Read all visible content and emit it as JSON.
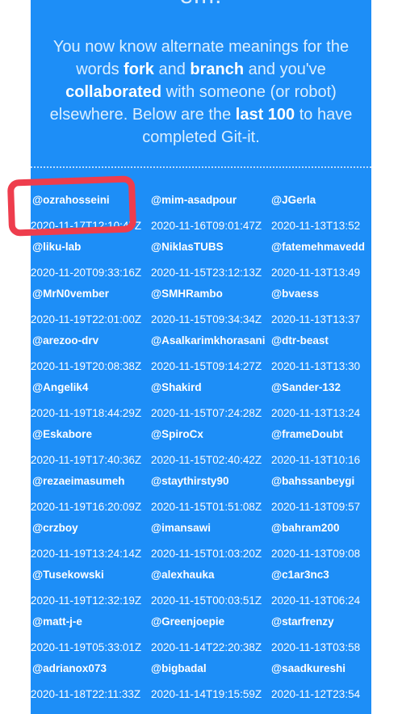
{
  "header": {
    "top_word": "em.",
    "intro_part1": "You now know alternate meanings for the words ",
    "intro_bold1": "fork",
    "intro_part2": " and ",
    "intro_bold2": "branch",
    "intro_part3": " and you've ",
    "intro_bold3": "collaborated",
    "intro_part4": " with someone (or robot) elsewhere. Below are the ",
    "intro_bold4": "last 100",
    "intro_part5": " to have completed Git-it."
  },
  "completers": [
    [
      {
        "user": "@ozrahosseini",
        "date": "2020-11-17T12:10:47Z"
      },
      {
        "user": "@mim-asadpour",
        "date": "2020-11-16T09:01:47Z"
      },
      {
        "user": "@JGerla",
        "date": "2020-11-13T13:52"
      }
    ],
    [
      {
        "user": "@liku-lab",
        "date": "2020-11-20T09:33:16Z"
      },
      {
        "user": "@NiklasTUBS",
        "date": "2020-11-15T23:12:13Z"
      },
      {
        "user": "@fatemehmavedd",
        "date": "2020-11-13T13:49"
      }
    ],
    [
      {
        "user": "@MrN0vember",
        "date": "2020-11-19T22:01:00Z"
      },
      {
        "user": "@SMHRambo",
        "date": "2020-11-15T09:34:34Z"
      },
      {
        "user": "@bvaess",
        "date": "2020-11-13T13:37"
      }
    ],
    [
      {
        "user": "@arezoo-drv",
        "date": "2020-11-19T20:08:38Z"
      },
      {
        "user": "@Asalkarimkhorasani",
        "date": "2020-11-15T09:14:27Z"
      },
      {
        "user": "@dtr-beast",
        "date": "2020-11-13T13:30"
      }
    ],
    [
      {
        "user": "@Angelik4",
        "date": "2020-11-19T18:44:29Z"
      },
      {
        "user": "@Shakird",
        "date": "2020-11-15T07:24:28Z"
      },
      {
        "user": "@Sander-132",
        "date": "2020-11-13T13:24"
      }
    ],
    [
      {
        "user": "@Eskabore",
        "date": "2020-11-19T17:40:36Z"
      },
      {
        "user": "@SpiroCx",
        "date": "2020-11-15T02:40:42Z"
      },
      {
        "user": "@frameDoubt",
        "date": "2020-11-13T10:16"
      }
    ],
    [
      {
        "user": "@rezaeimasumeh",
        "date": "2020-11-19T16:20:09Z"
      },
      {
        "user": "@staythirsty90",
        "date": "2020-11-15T01:51:08Z"
      },
      {
        "user": "@bahssanbeygi",
        "date": "2020-11-13T09:57"
      }
    ],
    [
      {
        "user": "@crzboy",
        "date": "2020-11-19T13:24:14Z"
      },
      {
        "user": "@imansawi",
        "date": "2020-11-15T01:03:20Z"
      },
      {
        "user": "@bahram200",
        "date": "2020-11-13T09:08"
      }
    ],
    [
      {
        "user": "@Tusekowski",
        "date": "2020-11-19T12:32:19Z"
      },
      {
        "user": "@alexhauka",
        "date": "2020-11-15T00:03:51Z"
      },
      {
        "user": "@c1ar3nc3",
        "date": "2020-11-13T06:24"
      }
    ],
    [
      {
        "user": "@matt-j-e",
        "date": "2020-11-19T05:33:01Z"
      },
      {
        "user": "@Greenjoepie",
        "date": "2020-11-14T22:20:38Z"
      },
      {
        "user": "@starfrenzy",
        "date": "2020-11-13T03:58"
      }
    ],
    [
      {
        "user": "@adrianox073",
        "date": "2020-11-18T22:11:33Z"
      },
      {
        "user": "@bigbadal",
        "date": "2020-11-14T19:15:59Z"
      },
      {
        "user": "@saadkureshi",
        "date": "2020-11-12T23:54"
      }
    ]
  ],
  "colors": {
    "panel": "#1d8ef7",
    "highlight": "#ee3d4d"
  }
}
